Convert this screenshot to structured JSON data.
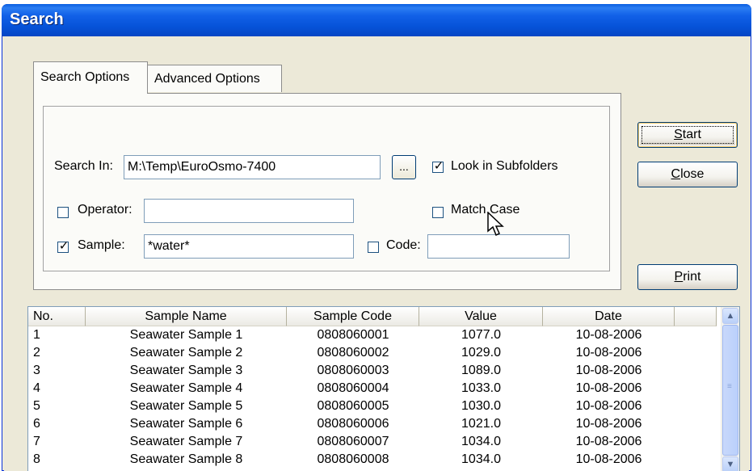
{
  "window": {
    "title": "Search"
  },
  "tabs": [
    {
      "label": "Search Options",
      "selected": true
    },
    {
      "label": "Advanced Options",
      "selected": false
    }
  ],
  "form": {
    "search_in_label": "Search In:",
    "search_in_value": "M:\\Temp\\EuroOsmo-7400",
    "browse_label": "...",
    "look_in_subfolders": {
      "label": "Look in Subfolders",
      "checked": true
    },
    "operator": {
      "label": "Operator:",
      "checked": false,
      "value": ""
    },
    "match_case": {
      "label": "Match Case",
      "checked": false
    },
    "sample": {
      "label": "Sample:",
      "checked": true,
      "value": "*water*"
    },
    "code": {
      "label": "Code:",
      "checked": false,
      "value": ""
    }
  },
  "buttons": {
    "start": {
      "label": "Start",
      "mnemonic": "S"
    },
    "close": {
      "label": "Close",
      "mnemonic": "C"
    },
    "print": {
      "label": "Print",
      "mnemonic": "P"
    }
  },
  "results": {
    "columns": [
      "No.",
      "Sample Name",
      "Sample Code",
      "Value",
      "Date"
    ],
    "rows": [
      [
        "1",
        "Seawater Sample 1",
        "0808060001",
        "1077.0",
        "10-08-2006"
      ],
      [
        "2",
        "Seawater Sample 2",
        "0808060002",
        "1029.0",
        "10-08-2006"
      ],
      [
        "3",
        "Seawater Sample 3",
        "0808060003",
        "1089.0",
        "10-08-2006"
      ],
      [
        "4",
        "Seawater Sample 4",
        "0808060004",
        "1033.0",
        "10-08-2006"
      ],
      [
        "5",
        "Seawater Sample 5",
        "0808060005",
        "1030.0",
        "10-08-2006"
      ],
      [
        "6",
        "Seawater Sample 6",
        "0808060006",
        "1021.0",
        "10-08-2006"
      ],
      [
        "7",
        "Seawater Sample 7",
        "0808060007",
        "1034.0",
        "10-08-2006"
      ],
      [
        "8",
        "Seawater Sample 8",
        "0808060008",
        "1034.0",
        "10-08-2006"
      ]
    ]
  },
  "colors": {
    "title_bar": "#0653d8",
    "dialog_bg": "#ece9d8",
    "scrollbar": "#c8d8fb"
  }
}
